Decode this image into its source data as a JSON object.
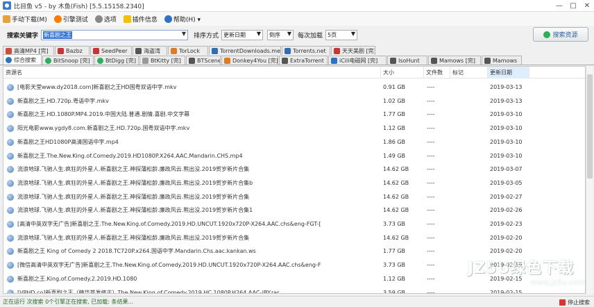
{
  "window": {
    "title": "比目鱼 v5 - by 木鱼(Fish) [5.5.15158.2340]",
    "controls": [
      "—",
      "□",
      "✕"
    ]
  },
  "menu": {
    "items": [
      {
        "label": "手动下载(M)",
        "icon": "download-icon"
      },
      {
        "label": "引擎测试",
        "icon": "test-icon"
      },
      {
        "label": "选项",
        "icon": "gear-icon"
      },
      {
        "label": "插件信息",
        "icon": "mail-icon"
      },
      {
        "label": "帮助(H) ▾",
        "icon": "help-icon"
      }
    ]
  },
  "search": {
    "keyword_label": "搜索关键字",
    "keyword_value": "新喜剧之王",
    "sort_label": "排序方式",
    "sort_value": "更新日期",
    "order_value": "倒序",
    "per_page_label": "每次加载",
    "per_page_value": "5页",
    "search_button": "搜索资源"
  },
  "engine_tabs_row1": [
    {
      "label": "高清MP4 [完]",
      "color": "#d24a3a"
    },
    {
      "label": "Bazbz",
      "color": "#c33"
    },
    {
      "label": "SeedPeer",
      "color": "#c33"
    },
    {
      "label": "海盗湾",
      "color": "#555"
    },
    {
      "label": "TorLock",
      "color": "#e07b22"
    },
    {
      "label": "TorrentDownloads.me",
      "color": "#2d6fb5"
    },
    {
      "label": "Torrents.net",
      "color": "#2d6fb5"
    },
    {
      "label": "天天美剧 [完]",
      "color": "#c33"
    }
  ],
  "engine_tabs_row2": [
    {
      "label": "综合搜索",
      "color": "#2d72c9",
      "active": true
    },
    {
      "label": "BitSnoop [完]",
      "color": "#2cae5a"
    },
    {
      "label": "BtDigg [完]",
      "color": "#2cae5a"
    },
    {
      "label": "BtKitty [完]",
      "color": "#999"
    },
    {
      "label": "BTScene",
      "color": "#555"
    },
    {
      "label": "Donkey4You [完]",
      "color": "#e07b22"
    },
    {
      "label": "ExtraTorrent",
      "color": "#555"
    },
    {
      "label": "iCili电磁网 [完]",
      "color": "#2d72c9"
    },
    {
      "label": "IsoHunt",
      "color": "#555"
    },
    {
      "label": "Mamows [完]",
      "color": "#555"
    },
    {
      "label": "Mamows",
      "color": "#555"
    }
  ],
  "table": {
    "columns": [
      "资源名",
      "大小",
      "文件数",
      "标记",
      "更新日期"
    ],
    "rows": [
      {
        "name": "[电影天堂www.dy2018.com]新喜剧之王HD国粤双语中字.mkv",
        "size": "0.91 GB",
        "files": "----",
        "date": "2019-03-13"
      },
      {
        "name": "新喜剧之王.HD.720p.粤语中字.mkv",
        "size": "1.02 GB",
        "files": "----",
        "date": "2019-03-13"
      },
      {
        "name": "新喜剧之王.HD.1080P.MP4.2019.中国大陆.普通.剧情.喜剧.中文字幕",
        "size": "1.77 GB",
        "files": "----",
        "date": "2019-03-10"
      },
      {
        "name": "阳光电影www.ygdy8.com.新喜剧之王.HD.720p.国粤双语中字.mkv",
        "size": "1.12 GB",
        "files": "----",
        "date": "2019-03-10"
      },
      {
        "name": "新喜剧之王HD1080P高清国语中字.mp4",
        "size": "1.86 GB",
        "files": "----",
        "date": "2019-03-10"
      },
      {
        "name": "新喜剧之王.The.New.King.of.Comedy.2019.HD1080P.X264.AAC.Mandarin.CHS.mp4",
        "size": "1.49 GB",
        "files": "----",
        "date": "2019-03-10"
      },
      {
        "name": "流浪地球.飞驰人生.疯狂的外星人.新喜剧之王.神探蒲松龄.廉政风云.熊出没.2019贺岁新片合集",
        "size": "14.62 GB",
        "files": "----",
        "date": "2019-03-07"
      },
      {
        "name": "流浪地球.飞驰人生.疯狂的外星人.新喜剧之王.神探蒲松龄.廉政风云.熊出没.2019贺岁新片合集b",
        "size": "14.62 GB",
        "files": "----",
        "date": "2019-03-05"
      },
      {
        "name": "流浪地球.飞驰人生.疯狂的外星人.新喜剧之王.神探蒲松龄.廉政风云.熊出没.2019贺岁新片合集",
        "size": "14.62 GB",
        "files": "----",
        "date": "2019-02-27"
      },
      {
        "name": "流浪地球.飞驰人生.疯狂的外星人.新喜剧之王.神探蒲松龄.廉政风云.熊出没.2019贺岁新片合集1",
        "size": "14.62 GB",
        "files": "----",
        "date": "2019-02-26"
      },
      {
        "name": "[高清中英双字无广告]新喜剧之王.The.New.King.of.Comedy.2019.HD.UNCUT.1920x720P-X264.AAC.chs&eng-FGT-[",
        "size": "3.73 GB",
        "files": "----",
        "date": "2019-02-23"
      },
      {
        "name": "流浪地球.飞驰人生.疯狂的外星人.新喜剧之王.神探蒲松龄.廉政风云.熊出没.2019贺岁新片合集",
        "size": "14.62 GB",
        "files": "----",
        "date": "2019-02-20"
      },
      {
        "name": "新喜剧之王 King of Comedy 2 2018.TC720P.x264.国语中字.Mandarin.Chs.aac.kankan.ws",
        "size": "1.77 GB",
        "files": "----",
        "date": "2019-02-20"
      },
      {
        "name": "[微信高清中英双字无广告]新喜剧之王.The.New.King.of.Comedy.2019.HD.UNCUT.1920x720P-X264.AAC.chs&eng-F",
        "size": "3.73 GB",
        "files": "----",
        "date": "2019-02-19"
      },
      {
        "name": "新喜剧之王.King.of.Comedy.2.2019.HD.1080",
        "size": "1.12 GB",
        "files": "----",
        "date": "2019-02-15"
      },
      {
        "name": "[VPHD.co]新喜剧之王（精华首发修正）The.New.King.of.Comedy.2019.HC.1080P.H264.AAC-JBY.rar",
        "size": "3.59 GB",
        "files": "----",
        "date": "2019-02-15"
      }
    ]
  },
  "status": {
    "text": "正在运行   次搜索 0个引擎正在搜索, 已加载: 条结果...",
    "stop_label": "停止搜索"
  },
  "watermark": {
    "line1": "JZ5U绿色下载",
    "line2": "www.jz5u.com"
  }
}
